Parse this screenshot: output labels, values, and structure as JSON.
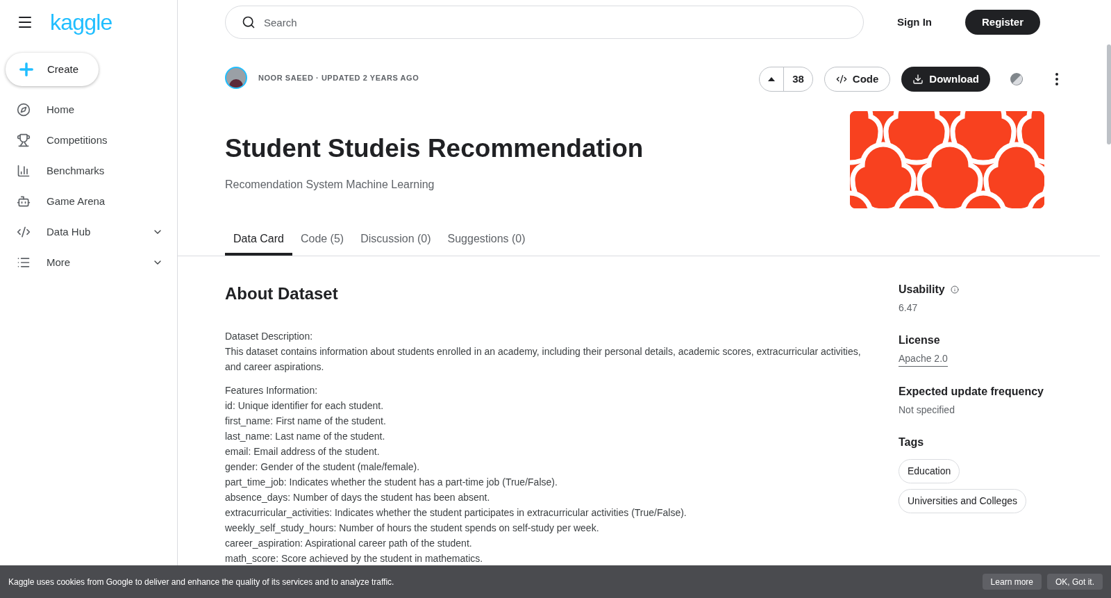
{
  "sidebar": {
    "logo": "kaggle",
    "create": "Create",
    "items": [
      {
        "label": "Home",
        "expandable": false
      },
      {
        "label": "Competitions",
        "expandable": false
      },
      {
        "label": "Benchmarks",
        "expandable": false
      },
      {
        "label": "Game Arena",
        "expandable": false
      },
      {
        "label": "Data Hub",
        "expandable": true
      },
      {
        "label": "More",
        "expandable": true
      }
    ]
  },
  "header": {
    "search": {
      "placeholder": "Search"
    },
    "sign_in": "Sign In",
    "register": "Register"
  },
  "dataset": {
    "byline": "NOOR SAEED · UPDATED 2 YEARS AGO",
    "votes": "38",
    "code_button": "Code",
    "download_button": "Download",
    "title": "Student Studeis Recommendation",
    "subtitle": "Recomendation System Machine Learning",
    "tabs": [
      {
        "label": "Data Card",
        "selected": true
      },
      {
        "label": "Code (5)",
        "selected": false
      },
      {
        "label": "Discussion (0)",
        "selected": false
      },
      {
        "label": "Suggestions (0)",
        "selected": false
      }
    ]
  },
  "about": {
    "heading": "About Dataset",
    "paragraphs": [
      [
        "Dataset Description:",
        "This dataset contains information about students enrolled in an academy, including their personal details, academic scores, extracurricular activities, and career aspirations."
      ],
      [
        "Features Information:",
        "id: Unique identifier for each student.",
        "first_name: First name of the student.",
        "last_name: Last name of the student.",
        "email: Email address of the student.",
        "gender: Gender of the student (male/female).",
        "part_time_job: Indicates whether the student has a part-time job (True/False).",
        "absence_days: Number of days the student has been absent.",
        "extracurricular_activities: Indicates whether the student participates in extracurricular activities (True/False).",
        "weekly_self_study_hours: Number of hours the student spends on self-study per week.",
        "career_aspiration: Aspirational career path of the student.",
        "math_score: Score achieved by the student in mathematics."
      ]
    ]
  },
  "details": {
    "usability": {
      "label": "Usability",
      "value": "6.47"
    },
    "license": {
      "label": "License",
      "value": "Apache 2.0"
    },
    "frequency": {
      "label": "Expected update frequency",
      "value": "Not specified"
    },
    "tags": {
      "label": "Tags",
      "items": [
        "Education",
        "Universities and Colleges"
      ]
    }
  },
  "cookie_bar": {
    "message": "Kaggle uses cookies from Google to deliver and enhance the quality of its services and to analyze traffic.",
    "buttons": [
      "Learn more",
      "OK, Got it."
    ]
  }
}
